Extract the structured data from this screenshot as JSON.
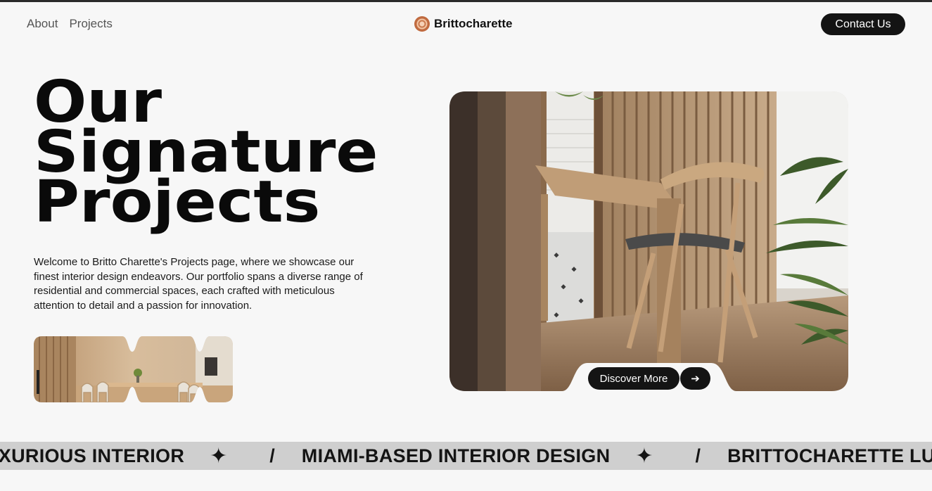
{
  "nav": {
    "links": [
      "About",
      "Projects"
    ],
    "brand": "Brittocharette",
    "contact_label": "Contact Us"
  },
  "hero": {
    "title_lines": [
      "Our",
      "Signature",
      "Projects"
    ],
    "description": "Welcome to Britto Charette's Projects page, where we showcase our finest interior design endeavors. Our portfolio spans a diverse range of residential and commercial spaces, each crafted with meticulous attention to detail and a passion for innovation.",
    "discover_label": "Discover More",
    "arrow_icon": "arrow-right-icon",
    "arrow_glyph": "➔"
  },
  "marquee": {
    "items": [
      "UXURIOUS INTERIOR",
      "MIAMI-BASED INTERIOR DESIGN",
      "BRITTOCHARETTE LUXURIOUS INTERIOR"
    ],
    "star_glyph": "✦",
    "separator": "/"
  },
  "colors": {
    "background": "#f7f7f7",
    "button_dark": "#141414",
    "marquee_bg": "#cfcfcf",
    "brand_accent": "#c9774a"
  }
}
